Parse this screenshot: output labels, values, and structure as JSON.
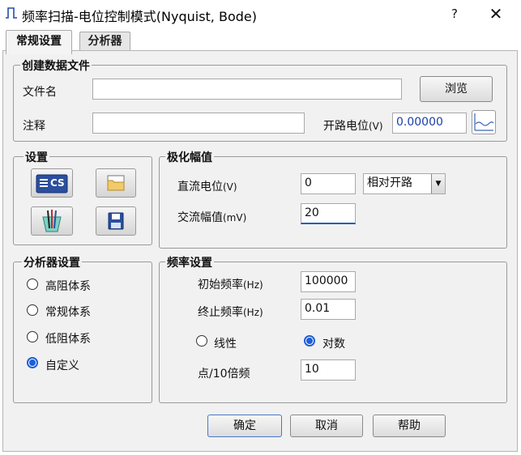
{
  "window": {
    "title": "频率扫描-电位控制模式(Nyquist, Bode)",
    "help_label": "?",
    "close_label": "✕"
  },
  "tabs": [
    {
      "label": "常规设置",
      "active": true
    },
    {
      "label": "分析器",
      "active": false
    }
  ],
  "create_file": {
    "title": "创建数据文件",
    "filename_label": "文件名",
    "filename_value": "",
    "browse_label": "浏览",
    "note_label": "注释",
    "note_value": "",
    "ocp_label": "开路电位",
    "ocp_unit": "(V)",
    "ocp_value": "0.00000",
    "ocp_icon": "waveform-icon"
  },
  "settings": {
    "title": "设置",
    "icons": [
      "cs-device-icon",
      "open-folder-icon",
      "electrode-icon",
      "save-disk-icon"
    ],
    "cs_text": "CS"
  },
  "polarization": {
    "title": "极化幅值",
    "dc_label": "直流电位",
    "dc_unit": "(V)",
    "dc_value": "0",
    "dc_ref_selected": "相对开路",
    "ac_label": "交流幅值",
    "ac_unit": "(mV)",
    "ac_value": "20"
  },
  "analyzer_settings": {
    "title": "分析器设置",
    "options": [
      {
        "label": "高阻体系",
        "checked": false
      },
      {
        "label": "常规体系",
        "checked": false
      },
      {
        "label": "低阻体系",
        "checked": false
      },
      {
        "label": "自定义",
        "checked": true
      }
    ]
  },
  "frequency": {
    "title": "频率设置",
    "start_label": "初始频率",
    "start_unit": "(Hz)",
    "start_value": "100000",
    "end_label": "终止频率",
    "end_unit": "(Hz)",
    "end_value": "0.01",
    "linear_label": "线性",
    "log_label": "对数",
    "scale_selected": "log",
    "points_label": "点/10倍频",
    "points_value": "10"
  },
  "footer": {
    "ok_label": "确定",
    "cancel_label": "取消",
    "help_label": "帮助"
  }
}
